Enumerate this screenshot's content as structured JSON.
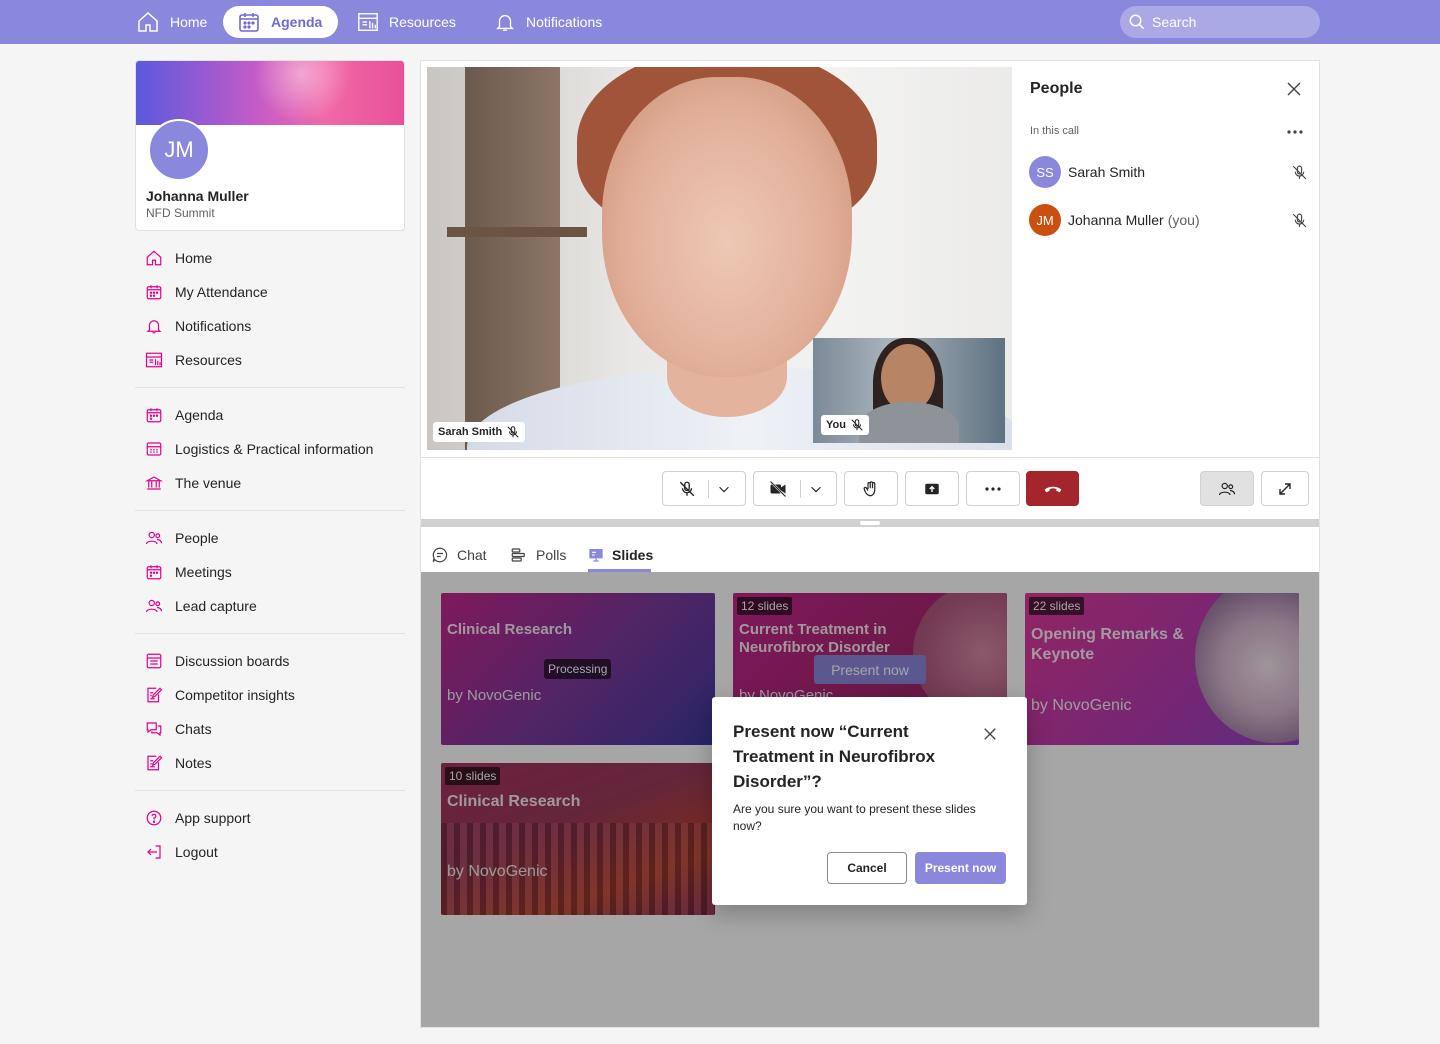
{
  "topnav": {
    "items": [
      {
        "label": "Home"
      },
      {
        "label": "Agenda"
      },
      {
        "label": "Resources"
      },
      {
        "label": "Notifications"
      }
    ],
    "search_placeholder": "Search"
  },
  "profile": {
    "initials": "JM",
    "name": "Johanna Muller",
    "event": "NFD Summit"
  },
  "sidebar": {
    "group1": [
      {
        "label": "Home",
        "icon": "home-icon"
      },
      {
        "label": "My Attendance",
        "icon": "calendar-icon"
      },
      {
        "label": "Notifications",
        "icon": "bell-icon"
      },
      {
        "label": "Resources",
        "icon": "resources-icon"
      }
    ],
    "group2": [
      {
        "label": "Agenda",
        "icon": "calendar-icon"
      },
      {
        "label": "Logistics & Practical information",
        "icon": "info-grid-icon"
      },
      {
        "label": "The venue",
        "icon": "venue-icon"
      }
    ],
    "group3": [
      {
        "label": "People",
        "icon": "people-icon"
      },
      {
        "label": "Meetings",
        "icon": "calendar-icon"
      },
      {
        "label": "Lead capture",
        "icon": "people-icon"
      }
    ],
    "group4": [
      {
        "label": "Discussion boards",
        "icon": "board-icon"
      },
      {
        "label": "Competitor insights",
        "icon": "note-edit-icon"
      },
      {
        "label": "Chats",
        "icon": "chat-icon"
      },
      {
        "label": "Notes",
        "icon": "note-edit-icon"
      }
    ],
    "group5": [
      {
        "label": "App support",
        "icon": "help-icon"
      },
      {
        "label": "Logout",
        "icon": "logout-icon"
      }
    ]
  },
  "call": {
    "main_label": "Sarah Smith",
    "self_label": "You"
  },
  "people_panel": {
    "title": "People",
    "subtitle": "In this call",
    "participants": [
      {
        "initials": "SS",
        "name": "Sarah Smith",
        "suffix": "",
        "color": "#8a88dc"
      },
      {
        "initials": "JM",
        "name": "Johanna Muller",
        "suffix": "(you)",
        "color": "#ca5010"
      }
    ]
  },
  "tabs": [
    {
      "label": "Chat"
    },
    {
      "label": "Polls"
    },
    {
      "label": "Slides"
    }
  ],
  "slides": [
    {
      "title": "Clinical Research",
      "by": "by NovoGenic",
      "badge": "",
      "status": "Processing"
    },
    {
      "title": "Current Treatment in Neurofibrox Disorder",
      "by": "by NovoGenic",
      "badge": "12 slides",
      "action": "Present now"
    },
    {
      "title": "Opening Remarks & Keynote",
      "by": "by NovoGenic",
      "badge": "22 slides"
    },
    {
      "title": "Clinical Research",
      "by": "by NovoGenic",
      "badge": "10 slides"
    }
  ],
  "modal": {
    "title": "Present now “Current Treatment in Neurofibrox Disorder”?",
    "body": "Are you sure you want to present these slides now?",
    "cancel": "Cancel",
    "confirm": "Present now"
  },
  "colors": {
    "brand": "#8a88dc",
    "accent_pink": "#e3008c",
    "end_call": "#c4314b"
  }
}
